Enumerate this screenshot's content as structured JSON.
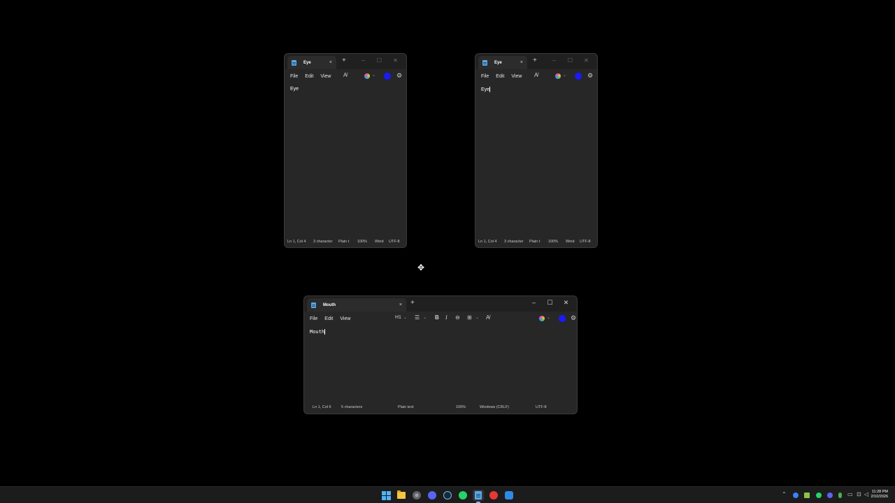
{
  "windows": [
    {
      "id": "eye-left",
      "tab_title": "Eye",
      "tab_close": "×",
      "new_tab": "+",
      "menu": [
        "File",
        "Edit",
        "View"
      ],
      "content": "Eye",
      "status": {
        "position": "Ln 1, Col 4",
        "characters": "3 character",
        "format": "Plain t",
        "zoom": "100%",
        "line_ending": "Wind",
        "encoding": "UTF-8"
      }
    },
    {
      "id": "eye-right",
      "tab_title": "Eye",
      "tab_close": "×",
      "new_tab": "+",
      "menu": [
        "File",
        "Edit",
        "View"
      ],
      "content": "Eye",
      "status": {
        "position": "Ln 1, Col 4",
        "characters": "3 character",
        "format": "Plain t",
        "zoom": "100%",
        "line_ending": "Wind",
        "encoding": "UTF-8"
      }
    },
    {
      "id": "mouth",
      "tab_title": "Mouth",
      "tab_close": "×",
      "new_tab": "+",
      "menu": [
        "File",
        "Edit",
        "View"
      ],
      "toolbar": {
        "heading": "H1"
      },
      "content": "Mouth",
      "status": {
        "position": "Ln 1, Col 6",
        "characters": "5 characters",
        "format": "Plain text",
        "zoom": "100%",
        "line_ending": "Windows (CRLF)",
        "encoding": "UTF-8"
      }
    }
  ],
  "taskbar": {
    "pinned_icons": [
      "start-icon",
      "file-explorer-icon",
      "chrome-icon",
      "discord-icon",
      "steam-icon",
      "whatsapp-icon",
      "notepad-icon",
      "app-icon",
      "quick-assist-icon"
    ],
    "active": "notepad-icon",
    "clock": {
      "time": "11:28 PM",
      "date": "2/10/2026"
    }
  },
  "colors": {
    "window_bg": "#272727",
    "titlebar_bg": "#202020",
    "desktop_bg": "#000000",
    "accent": "#1a1aff"
  }
}
